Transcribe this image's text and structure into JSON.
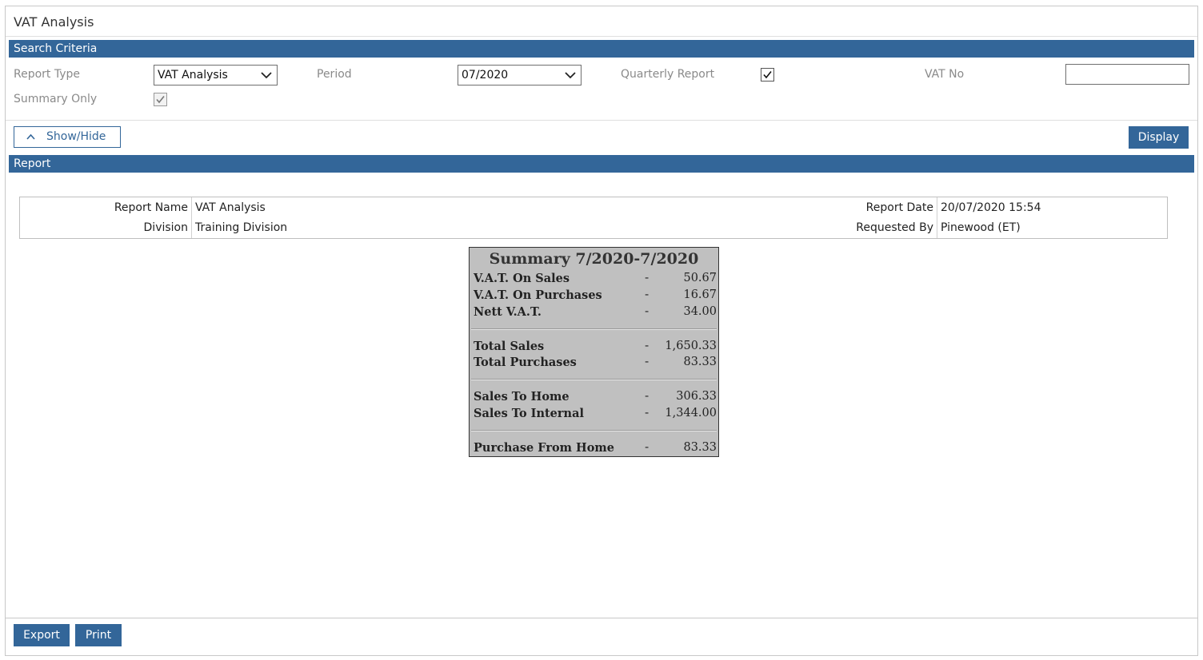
{
  "page": {
    "title": "VAT Analysis"
  },
  "search_criteria": {
    "header": "Search Criteria",
    "report_type": {
      "label": "Report Type",
      "value": "VAT Analysis"
    },
    "period": {
      "label": "Period",
      "value": "07/2020"
    },
    "quarterly_report": {
      "label": "Quarterly Report",
      "checked": true
    },
    "vat_no": {
      "label": "VAT No",
      "value": ""
    },
    "summary_only": {
      "label": "Summary Only",
      "checked": true,
      "disabled": true
    }
  },
  "toolbar": {
    "show_hide_label": "Show/Hide",
    "display_label": "Display"
  },
  "report": {
    "header": "Report",
    "info": {
      "report_name_label": "Report Name",
      "report_name": "VAT Analysis",
      "division_label": "Division",
      "division": "Training Division",
      "report_date_label": "Report Date",
      "report_date": "20/07/2020 15:54",
      "requested_by_label": "Requested By",
      "requested_by": "Pinewood (ET)"
    },
    "summary": {
      "title": "Summary 7/2020-7/2020",
      "groups": [
        [
          {
            "label": "V.A.T. On Sales",
            "dash": "-",
            "value": "50.67"
          },
          {
            "label": "V.A.T. On Purchases",
            "dash": "-",
            "value": "16.67"
          },
          {
            "label": "Nett V.A.T.",
            "dash": "-",
            "value": "34.00"
          }
        ],
        [
          {
            "label": "Total Sales",
            "dash": "-",
            "value": "1,650.33"
          },
          {
            "label": "Total Purchases",
            "dash": "-",
            "value": "83.33"
          }
        ],
        [
          {
            "label": "Sales To Home",
            "dash": "-",
            "value": "306.33"
          },
          {
            "label": "Sales To Internal",
            "dash": "-",
            "value": "1,344.00"
          }
        ],
        [
          {
            "label": "Purchase From Home",
            "dash": "-",
            "value": "83.33"
          }
        ]
      ]
    }
  },
  "footer": {
    "export_label": "Export",
    "print_label": "Print"
  },
  "colors": {
    "accent": "#336699"
  },
  "icons": {
    "select_arrow": "chevron-down-icon",
    "show_hide": "chevron-up-icon",
    "checkbox": "checkmark-icon"
  }
}
